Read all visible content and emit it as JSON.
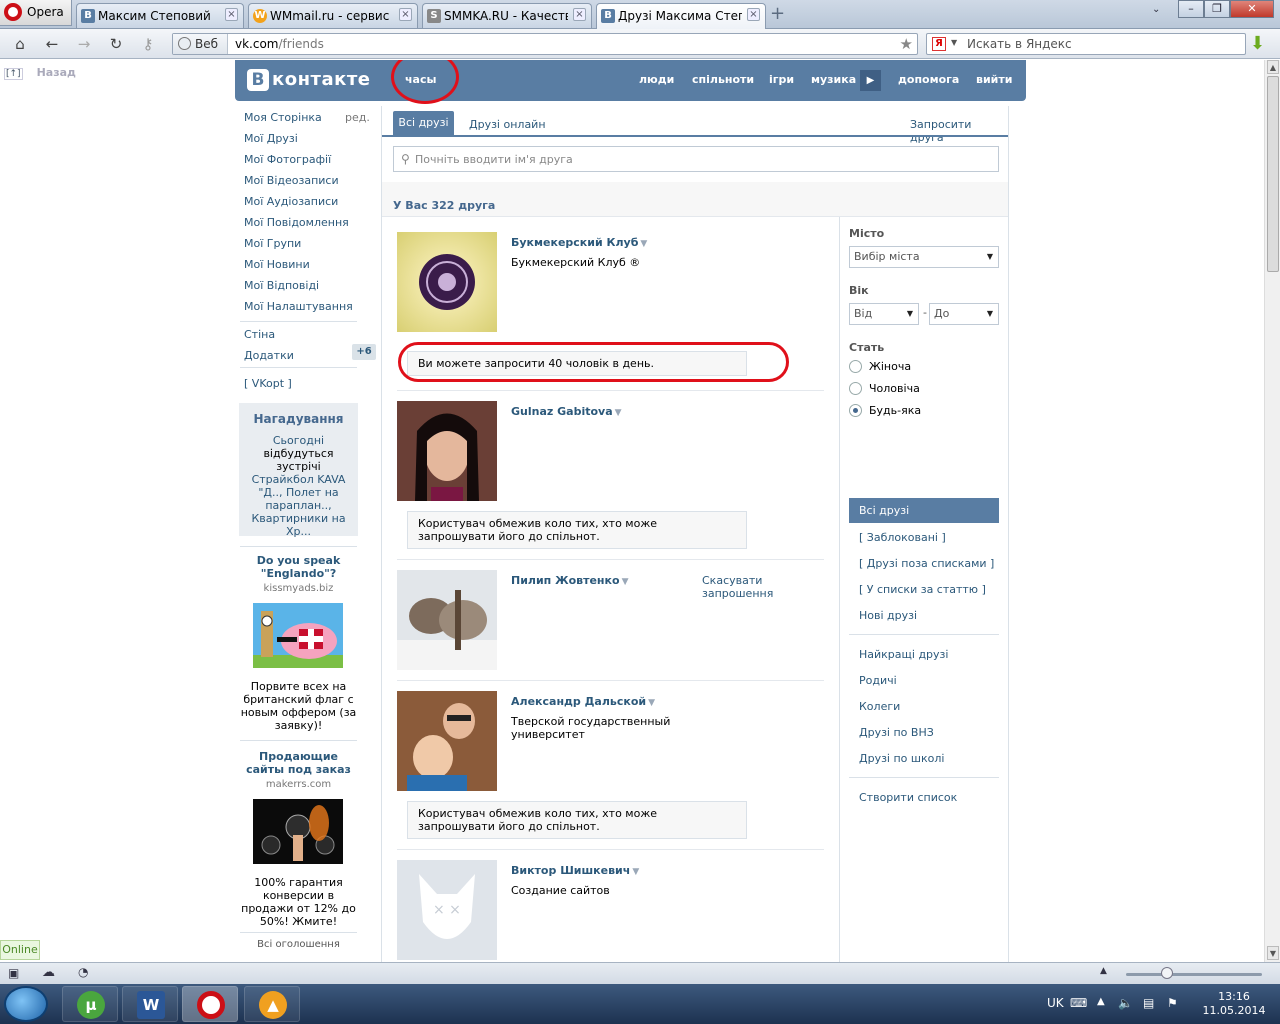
{
  "browser": {
    "menu_label": "Opera",
    "tabs": [
      {
        "label": "Максим Степовий",
        "icon": "В"
      },
      {
        "label": "WMmail.ru - сервис п...",
        "icon": "W"
      },
      {
        "label": "SMMKA.RU - Качестве...",
        "icon": "S"
      },
      {
        "label": "Друзі Максима Степо...",
        "icon": "В"
      }
    ],
    "address_badge": "Веб",
    "url_host": "vk.com",
    "url_path": "/friends",
    "search_placeholder": "Искать в Яндекс",
    "yandex_letter": "Я"
  },
  "page": {
    "back_label": "Назад",
    "back_marker": "[↑]",
    "logo_letter": "В",
    "logo_text": "контакте",
    "top_user": "часы",
    "top_nav": [
      "люди",
      "спільноти",
      "ігри",
      "музика",
      "допомога",
      "вийти"
    ],
    "left_menu": [
      "Моя Сторінка",
      "Мої Друзі",
      "Мої Фотографії",
      "Мої Відеозаписи",
      "Мої Аудіозаписи",
      "Мої Повідомлення",
      "Мої Групи",
      "Мої Новини",
      "Мої Відповіді",
      "Мої Налаштування"
    ],
    "edit_label": "ред.",
    "wall_label": "Стіна",
    "apps_label": "Додатки",
    "apps_badge": "+6",
    "vkopt_label": "[ VKopt ]",
    "reminder": {
      "title": "Нагадування",
      "today": "Сьогодні",
      "text": "відбудуться зустрічі",
      "events": "Страйкбол KAVA \"Д.., Полет на параплан.., Квартирники на Хр..."
    },
    "ads": [
      {
        "title": "Do you speak \"Englando\"?",
        "domain": "kissmyads.biz",
        "text": "Порвите всех на британский флаг с новым оффером (за заявку)!"
      },
      {
        "title": "Продающие сайты под заказ",
        "domain": "makerrs.com",
        "text": "100% гарантия конверсии в продажи от 12% до 50%! Жмите!"
      }
    ],
    "ads_all": "Всі оголошення",
    "tabs": {
      "all": "Всі друзі",
      "online": "Друзі онлайн",
      "invite": "Запросити друга"
    },
    "search_placeholder": "Почніть вводити ім'я друга",
    "friends_count": "У Вас 322 друга",
    "friends": [
      {
        "name": "Букмекерский Клуб",
        "desc": "Букмекерский Клуб ®",
        "notice": "Ви можете запросити 40 чоловік в день."
      },
      {
        "name": "Gulnaz Gabitova",
        "desc": "",
        "notice": "Користувач обмежив коло тих, хто може запрошувати його до спільнот."
      },
      {
        "name": "Пилип Жовтенко",
        "desc": "",
        "notice": "",
        "action": "Скасувати запрошення"
      },
      {
        "name": "Александр Дальской",
        "desc": "Тверской государственный университет",
        "notice": "Користувач обмежив коло тих, хто може запрошувати його до спільнот."
      },
      {
        "name": "Виктор Шишкевич",
        "desc": "Создание сайтов",
        "notice": ""
      }
    ],
    "filter": {
      "city_label": "Місто",
      "city_placeholder": "Вибір міста",
      "age_label": "Вік",
      "age_from": "Від",
      "age_dash": "-",
      "age_to": "До",
      "sex_label": "Стать",
      "sex_options": [
        "Жіноча",
        "Чоловіча",
        "Будь-яка"
      ],
      "sex_selected": "Будь-яка",
      "lists": [
        "Всі друзі",
        "[ Заблоковані ]",
        "[ Друзі поза списками ]",
        "[ У списки за статтю ]",
        "Нові друзі"
      ],
      "categories": [
        "Найкращі друзі",
        "Родичі",
        "Колеги",
        "Друзі по ВНЗ",
        "Друзі по школі"
      ],
      "create_list": "Створити список"
    }
  },
  "status": {
    "online": "Online"
  },
  "taskbar": {
    "lang": "UK",
    "time": "13:16",
    "date": "11.05.2014"
  },
  "colors": {
    "vk_blue": "#597da3",
    "link": "#2b587a",
    "annotation_red": "#e0101a"
  }
}
